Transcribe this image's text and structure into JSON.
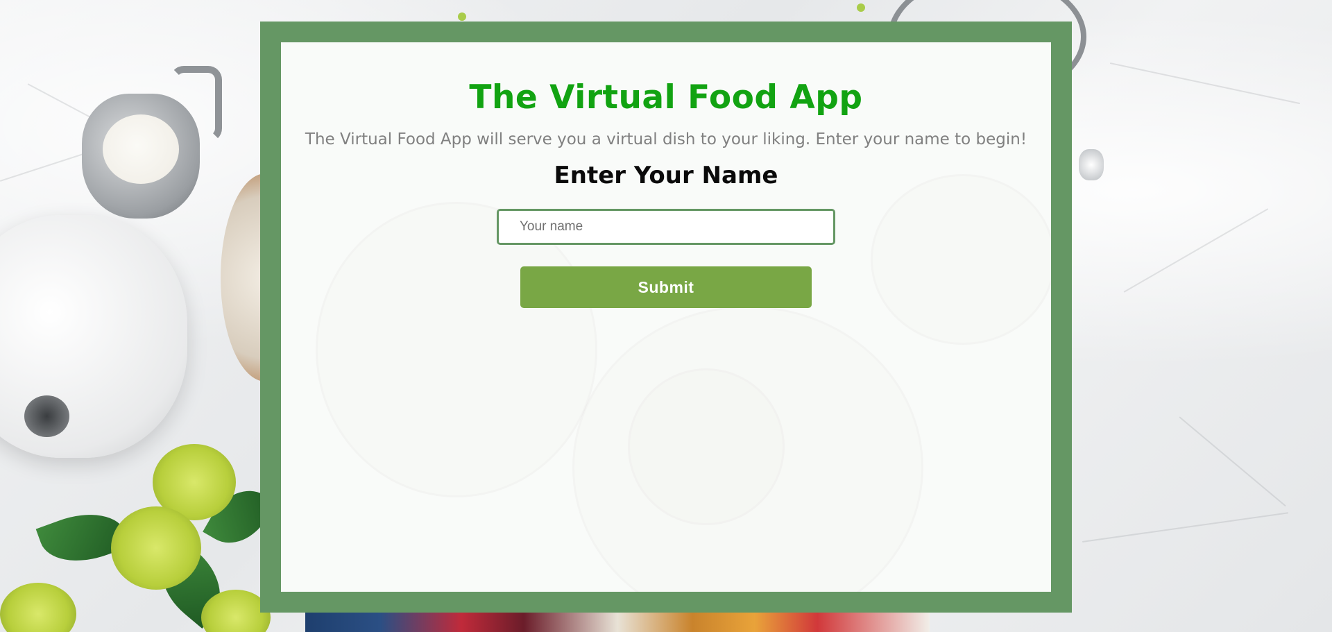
{
  "app": {
    "title": "The Virtual Food App",
    "description": "The Virtual Food App will serve you a virtual dish to your liking. Enter your name to begin!"
  },
  "form": {
    "heading": "Enter Your Name",
    "name_input": {
      "placeholder": "Your name",
      "value": ""
    },
    "submit_label": "Submit"
  },
  "colors": {
    "frame": "#659764",
    "title": "#12a312",
    "button": "#79a745",
    "input_border": "#659764",
    "subtitle": "#808080"
  }
}
